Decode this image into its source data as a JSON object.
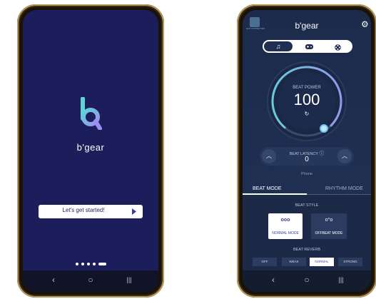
{
  "splash": {
    "brand": "b'gear",
    "start_button": "Let's get started!",
    "page_dots": 5,
    "active_dot": 5,
    "nav": {
      "back": "‹",
      "home": "○",
      "recents": "|||"
    }
  },
  "main": {
    "header": {
      "title": "b'gear",
      "device_label": "NOT CONNECTED"
    },
    "tabs": [
      {
        "name": "music",
        "icon": "♫",
        "active": true
      },
      {
        "name": "game",
        "icon": "🎮",
        "active": false
      },
      {
        "name": "movie",
        "icon": "🎞",
        "active": false
      }
    ],
    "beat_power": {
      "label": "BEAT POWER",
      "value": "100",
      "refresh_icon": "↻",
      "level": 1.0
    },
    "beat_latency": {
      "label": "BEAT LATENCY",
      "value": "0",
      "device": "Phone",
      "info_icon": "ⓘ"
    },
    "mode_tabs": [
      {
        "label": "BEAT MODE",
        "active": true
      },
      {
        "label": "RHYTHM MODE",
        "active": false
      }
    ],
    "beat_style": {
      "label": "BEAT STYLE",
      "options": [
        {
          "label": "NORMAL MODE",
          "icon": "ooo",
          "selected": true
        },
        {
          "label": "OFFBEAT MODE",
          "icon": "o°o",
          "selected": false
        }
      ]
    },
    "beat_reverb": {
      "label": "BEAT REVERB",
      "options": [
        {
          "label": "OFF",
          "selected": false
        },
        {
          "label": "WEAK",
          "selected": false
        },
        {
          "label": "NORMAL",
          "selected": true
        },
        {
          "label": "STRONG",
          "selected": false
        }
      ]
    },
    "nav": {
      "back": "‹",
      "home": "○",
      "recents": "|||"
    }
  },
  "colors": {
    "accent_teal": "#5fd4d4",
    "accent_purple": "#9a8ff0",
    "splash_bg": "#1c1e5b"
  }
}
